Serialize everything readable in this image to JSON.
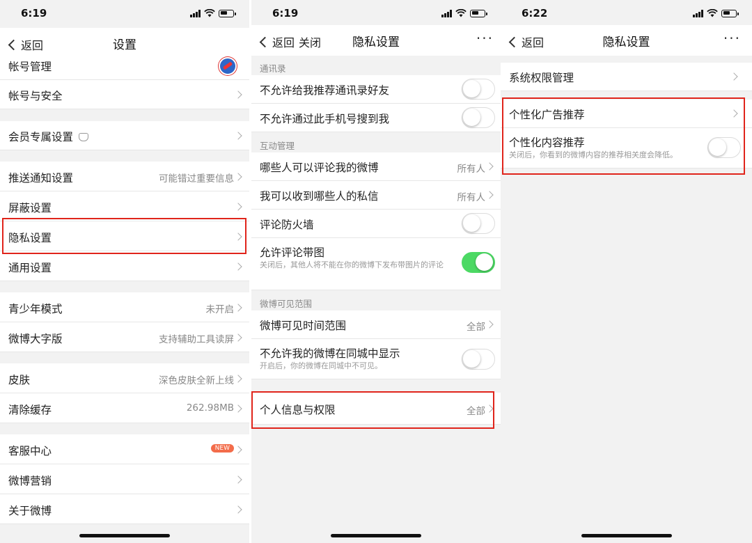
{
  "panel1": {
    "status_time": "6:19",
    "back_label": "返回",
    "title": "设置",
    "items": {
      "account_mgmt": "帐号管理",
      "account_security": "帐号与安全",
      "member_settings": "会员专属设置",
      "push": "推送通知设置",
      "push_value": "可能错过重要信息",
      "block": "屏蔽设置",
      "privacy": "隐私设置",
      "general": "通用设置",
      "youth": "青少年模式",
      "youth_value": "未开启",
      "large_font": "微博大字版",
      "large_font_value": "支持辅助工具读屏",
      "skin": "皮肤",
      "skin_value": "深色皮肤全新上线",
      "cache": "清除缓存",
      "cache_value": "262.98MB",
      "service": "客服中心",
      "service_badge": "NEW",
      "marketing": "微博营销",
      "about": "关于微博"
    }
  },
  "panel2": {
    "status_time": "6:19",
    "back_label": "返回",
    "close_label": "关闭",
    "title": "隐私设置",
    "more": "···",
    "sections": {
      "contacts": "通讯录",
      "interaction": "互动管理",
      "visibility": "微博可见范围"
    },
    "items": {
      "no_recommend_contacts": "不允许给我推荐通讯录好友",
      "no_search_by_phone": "不允许通过此手机号搜到我",
      "who_comment": "哪些人可以评论我的微博",
      "who_comment_value": "所有人",
      "who_message": "我可以收到哪些人的私信",
      "who_message_value": "所有人",
      "comment_firewall": "评论防火墙",
      "allow_comment_images": "允许评论带图",
      "allow_comment_images_sub": "关闭后，其他人将不能在你的微博下发布带图片的评论",
      "visible_time": "微博可见时间范围",
      "visible_time_value": "全部",
      "no_same_city": "不允许我的微博在同城中显示",
      "no_same_city_sub": "开启后，你的微博在同城中不可见。",
      "personal_info": "个人信息与权限",
      "personal_info_value": "全部"
    },
    "toggles": {
      "no_recommend_contacts": false,
      "no_search_by_phone": false,
      "comment_firewall": false,
      "allow_comment_images": true,
      "no_same_city": false
    }
  },
  "panel3": {
    "status_time": "6:22",
    "back_label": "返回",
    "title": "隐私设置",
    "more": "···",
    "items": {
      "system_permissions": "系统权限管理",
      "personalized_ads": "个性化广告推荐",
      "personalized_content": "个性化内容推荐",
      "personalized_content_sub": "关闭后，你看到的微博内容的推荐相关度会降低。"
    },
    "toggles": {
      "personalized_content": false
    }
  },
  "colors": {
    "highlight": "#e0241b",
    "toggle_on": "#4cd964",
    "badge": "#f36c4a",
    "background": "#f2f2f2"
  }
}
